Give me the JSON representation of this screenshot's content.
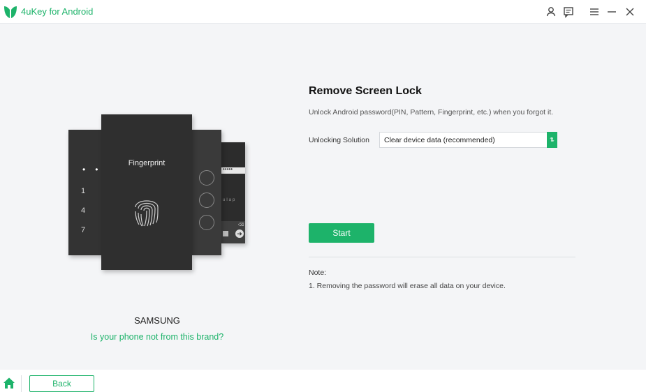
{
  "app": {
    "title": "4uKey for Android",
    "accent_color": "#1db36a"
  },
  "titlebar": {
    "icons": [
      "user-icon",
      "feedback-icon",
      "menu-icon",
      "minimize-icon",
      "close-icon"
    ]
  },
  "illustration": {
    "pin_digits": [
      "1",
      "4",
      "7"
    ],
    "fingerprint_label": "Fingerprint",
    "password_mask": "•••••",
    "password_hint": "ulap"
  },
  "device": {
    "brand": "SAMSUNG",
    "not_brand_link": "Is your phone not from this brand?"
  },
  "panel": {
    "heading": "Remove Screen Lock",
    "subtitle": "Unlock Android password(PIN, Pattern, Fingerprint, etc.) when you forgot it.",
    "solution_label": "Unlocking Solution",
    "solution_value": "Clear device data (recommended)",
    "start_label": "Start",
    "note_title": "Note:",
    "note_text": "1. Removing the password will erase all data on your device."
  },
  "bottombar": {
    "back_label": "Back"
  }
}
